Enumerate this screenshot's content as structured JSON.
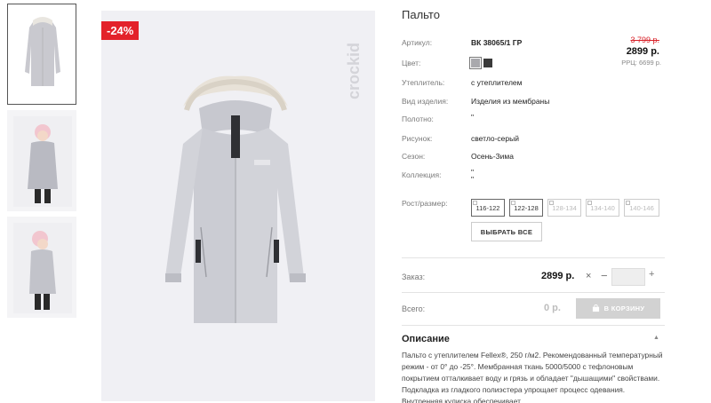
{
  "product": {
    "title": "Пальто",
    "discount_badge": "-24%",
    "brand": "crockid"
  },
  "thumbnails": [
    {
      "label": "photo-1",
      "active": true
    },
    {
      "label": "photo-2",
      "active": false
    },
    {
      "label": "photo-3",
      "active": false
    }
  ],
  "props": {
    "article_label": "Артикул:",
    "article_value": "ВК 38065/1 ГР",
    "color_label": "Цвет:",
    "insulation_label": "Утеплитель:",
    "insulation_value": "с утеплителем",
    "type_label": "Вид изделия:",
    "type_value": "Изделия из мембраны",
    "fabric_label": "Полотно:",
    "fabric_value": "\"",
    "pattern_label": "Рисунок:",
    "pattern_value": "светло-серый",
    "season_label": "Сезон:",
    "season_value": "Осень-Зима",
    "collection_label": "Коллекция:",
    "collection_value_1": "\"",
    "collection_value_2": "\"",
    "size_label": "Рост/размер:"
  },
  "price": {
    "old": "3 799 р.",
    "new": "2899 р.",
    "rrp": "РРЦ: 6699 р."
  },
  "colors": {
    "swatch_1": "#a9a9ad",
    "swatch_2": "#3a3a3a"
  },
  "sizes": [
    {
      "label": "116-122",
      "available": true
    },
    {
      "label": "122-128",
      "available": true
    },
    {
      "label": "128-134",
      "available": false
    },
    {
      "label": "134-140",
      "available": false
    },
    {
      "label": "140-146",
      "available": false
    }
  ],
  "select_all_label": "ВЫБРАТЬ ВСЕ",
  "order": {
    "label": "Заказ:",
    "price": "2899 р.",
    "x": "×",
    "minus": "−",
    "plus": "+",
    "qty": ""
  },
  "total": {
    "label": "Всего:",
    "value": "0 р.",
    "cart_label": "В КОРЗИНУ"
  },
  "description": {
    "title": "Описание",
    "text": "Пальто с утеплителем Fellex®, 250 г/м2. Рекомендованный температурный режим - от 0° до -25°. Мембранная ткань 5000/5000 с тефлоновым покрытием отталкивает воду и грязь и обладает \"дышащими\" свойствами. Подкладка из гладкого полиэстера упрощает процесс одевания. Внутренняя кулиска обеспечивает"
  }
}
